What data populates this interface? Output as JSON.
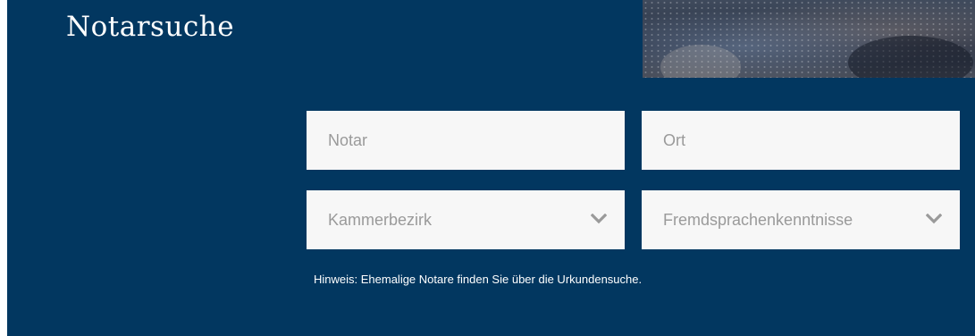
{
  "header": {
    "title": "Notarsuche"
  },
  "search": {
    "notar_placeholder": "Notar",
    "ort_placeholder": "Ort",
    "kammerbezirk_value": "Kammerbezirk",
    "fremdsprachen_value": "Fremdsprachenkenntnisse"
  },
  "hint": {
    "text": "Hinweis: Ehemalige Notare finden Sie über die Urkundensuche."
  },
  "colors": {
    "panel_background": "#023760",
    "field_background": "#f7f7f7",
    "placeholder_text": "#9a9a9a",
    "chevron": "#9a9a9a",
    "title_text": "#ffffff"
  },
  "icons": {
    "dropdown": "chevron-down-icon"
  }
}
